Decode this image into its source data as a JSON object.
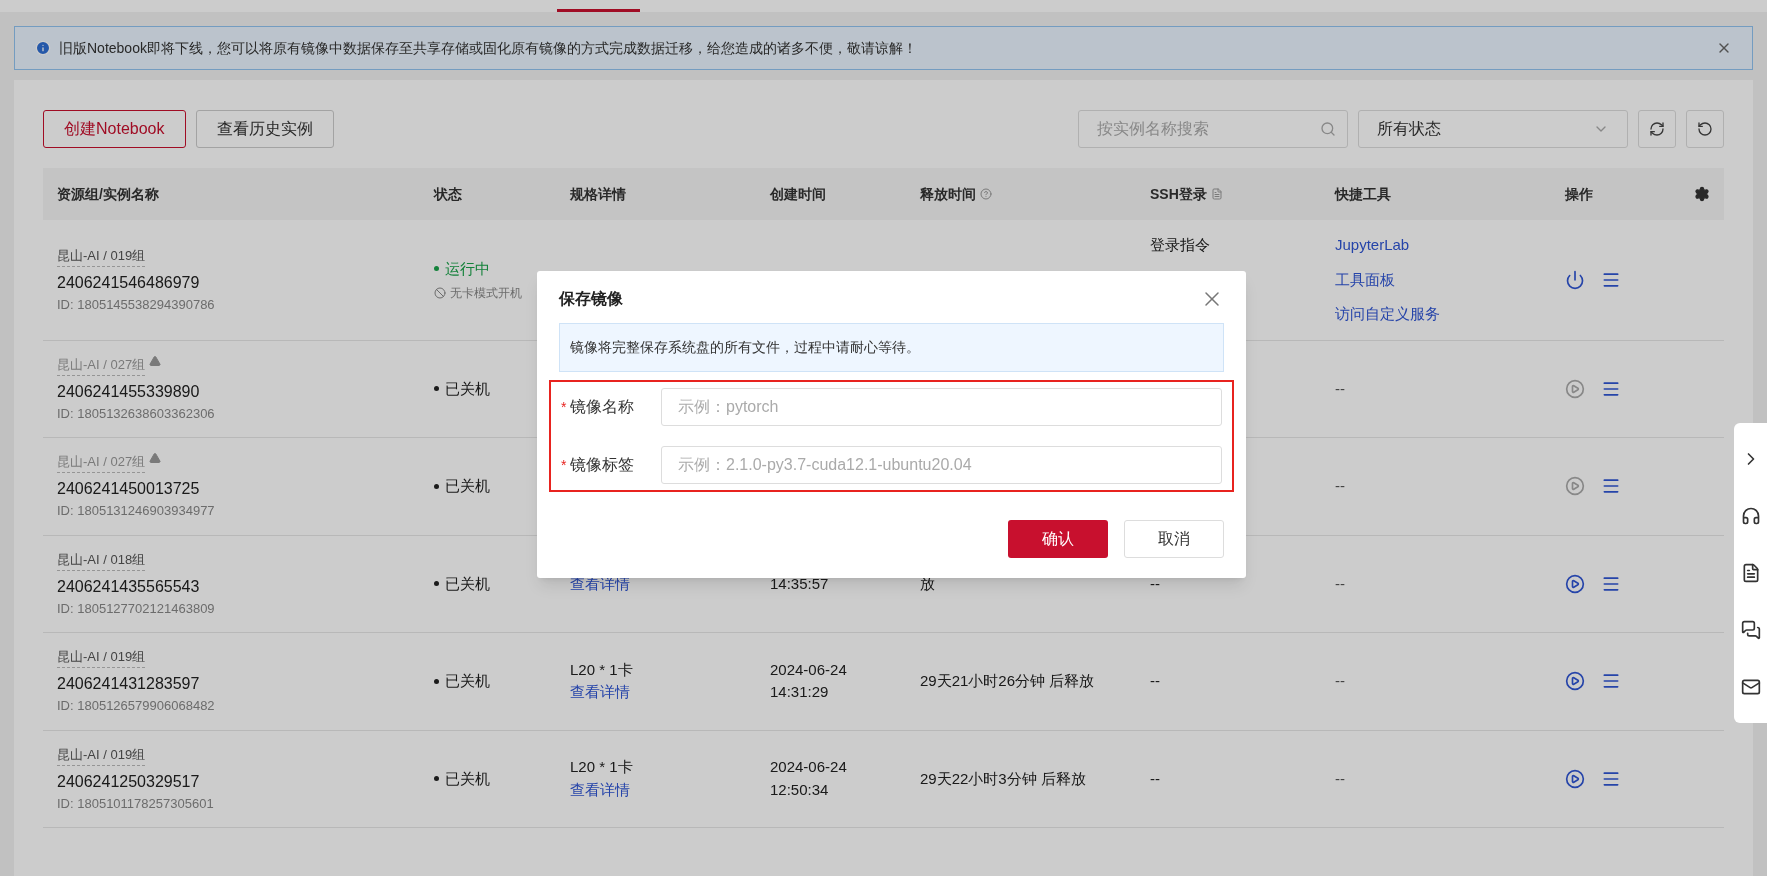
{
  "notice": {
    "text": "旧版Notebook即将下线，您可以将原有镜像中数据保存至共享存储或固化原有镜像的方式完成数据迁移，给您造成的诸多不便，敬请谅解！"
  },
  "toolbar": {
    "buttons": [
      {
        "label": "创建Notebook",
        "kind": "primary"
      },
      {
        "label": "查看历史实例",
        "kind": "default"
      }
    ],
    "search": {
      "placeholder": "按实例名称搜索"
    },
    "status_filter": {
      "value": "所有状态"
    }
  },
  "table": {
    "columns": [
      {
        "label": "资源组/实例名称"
      },
      {
        "label": "状态"
      },
      {
        "label": "规格详情"
      },
      {
        "label": "创建时间"
      },
      {
        "label": "释放时间",
        "kind": "tooltip"
      },
      {
        "label": "SSH登录",
        "kind": "guide"
      },
      {
        "label": "快捷工具"
      },
      {
        "label": "操作"
      }
    ],
    "rows": [
      {
        "group": "昆山-AI / 019组",
        "warning": false,
        "name": "2406241546486979",
        "id": "ID: 1805145538294390786",
        "status": {
          "label": "运行中",
          "kind": "running",
          "note": "无卡模式开机"
        },
        "ssh": "登录指令",
        "tools": [
          "JupyterLab",
          "工具面板",
          "访问自定义服务"
        ],
        "action": {
          "kind": "power",
          "disabled": false
        }
      },
      {
        "group": "昆山-AI / 027组",
        "warning": true,
        "name": "2406241455339890",
        "id": "ID: 1805132638603362306",
        "status": {
          "label": "已关机",
          "kind": "stopped"
        },
        "tools": [
          "--"
        ],
        "action": {
          "kind": "play",
          "disabled": true
        }
      },
      {
        "group": "昆山-AI / 027组",
        "warning": true,
        "name": "2406241450013725",
        "id": "ID: 1805131246903934977",
        "status": {
          "label": "已关机",
          "kind": "stopped"
        },
        "tools": [
          "--"
        ],
        "action": {
          "kind": "play",
          "disabled": true
        }
      },
      {
        "group": "昆山-AI / 018组",
        "warning": false,
        "name": "2406241435565543",
        "id": "ID: 1805127702121463809",
        "status": {
          "label": "已关机",
          "kind": "stopped"
        },
        "spec": {
          "link": "查看详情"
        },
        "created": [
          "14:35:57"
        ],
        "release": "放",
        "ssh": "--",
        "tools": [
          "--"
        ],
        "action": {
          "kind": "play",
          "disabled": false
        }
      },
      {
        "group": "昆山-AI / 019组",
        "warning": false,
        "name": "2406241431283597",
        "id": "ID: 1805126579906068482",
        "status": {
          "label": "已关机",
          "kind": "stopped"
        },
        "spec": {
          "text": "L20 * 1卡",
          "link": "查看详情"
        },
        "created": [
          "2024-06-24",
          "14:31:29"
        ],
        "release": "29天21小时26分钟 后释放",
        "ssh": "--",
        "tools": [
          "--"
        ],
        "action": {
          "kind": "play",
          "disabled": false
        }
      },
      {
        "group": "昆山-AI / 019组",
        "warning": false,
        "name": "2406241250329517",
        "id": "ID: 1805101178257305601",
        "status": {
          "label": "已关机",
          "kind": "stopped"
        },
        "spec": {
          "text": "L20 * 1卡",
          "link": "查看详情"
        },
        "created": [
          "2024-06-24",
          "12:50:34"
        ],
        "release": "29天22小时3分钟 后释放",
        "ssh": "--",
        "tools": [
          "--"
        ],
        "action": {
          "kind": "play",
          "disabled": false
        }
      }
    ]
  },
  "dialog": {
    "title": "保存镜像",
    "info": "镜像将完整保存系统盘的所有文件，过程中请耐心等待。",
    "highlight": true,
    "fields": [
      {
        "label": "镜像名称",
        "required_mark": "*",
        "placeholder": "示例：pytorch"
      },
      {
        "label": "镜像标签",
        "required_mark": "*",
        "placeholder": "示例：2.1.0-py3.7-cuda12.1-ubuntu20.04"
      }
    ],
    "buttons": [
      {
        "label": "确认",
        "kind": "primary"
      },
      {
        "label": "取消",
        "kind": "default"
      }
    ]
  }
}
